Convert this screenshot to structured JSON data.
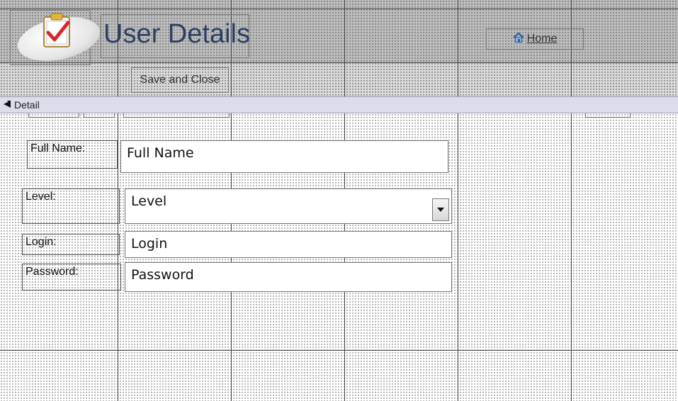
{
  "header": {
    "title": "User Details",
    "home_label": "Home",
    "save_close_label": "Save and Close"
  },
  "section": {
    "detail_label": "Detail"
  },
  "fields": {
    "full_name": {
      "label": "Full Name:",
      "value": "Full Name"
    },
    "level": {
      "label": "Level:",
      "value": "Level"
    },
    "login": {
      "label": "Login:",
      "value": "Login"
    },
    "password": {
      "label": "Password:",
      "value": "Password"
    }
  },
  "icons": {
    "logo": "clipboard-check-icon",
    "home": "home-icon",
    "section": "section-arrow-icon",
    "dropdown": "dropdown-arrow-icon"
  },
  "colors": {
    "title": "#2c3f63",
    "header_bg": "#bdbdbd",
    "section_bar": "#dcdcea"
  }
}
